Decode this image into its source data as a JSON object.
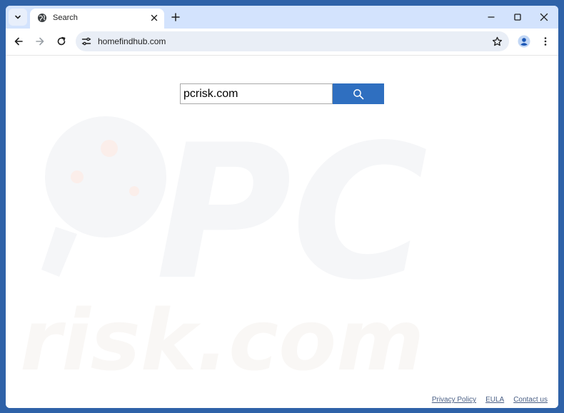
{
  "browser": {
    "tab_title": "Search",
    "url": "homefindhub.com"
  },
  "page": {
    "search_value": "pcrisk.com"
  },
  "footer": {
    "links": [
      "Privacy Policy",
      "EULA",
      "Contact us"
    ]
  },
  "watermark": {
    "text": "risk.com",
    "letters": "PC"
  },
  "colors": {
    "desktop": "#2f62a8",
    "titlebar": "#d3e3fd",
    "search_button": "#2f6fc0",
    "footer_link": "#4a5f85"
  }
}
